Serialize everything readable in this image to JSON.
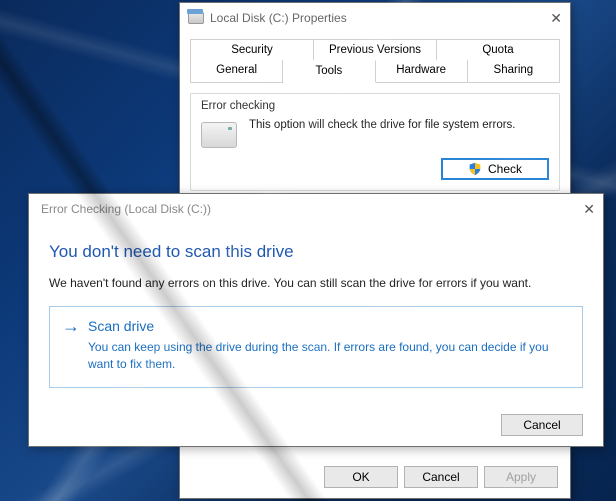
{
  "properties": {
    "title": "Local Disk (C:) Properties",
    "tabs_row1": [
      "Security",
      "Previous Versions",
      "Quota"
    ],
    "tabs_row2": [
      "General",
      "Tools",
      "Hardware",
      "Sharing"
    ],
    "active_tab": "Tools",
    "error_checking": {
      "group_label": "Error checking",
      "description": "This option will check the drive for file system errors.",
      "check_button": "Check"
    },
    "buttons": {
      "ok": "OK",
      "cancel": "Cancel",
      "apply": "Apply"
    }
  },
  "error_dialog": {
    "title": "Error Checking (Local Disk (C:))",
    "heading": "You don't need to scan this drive",
    "body": "We haven't found any errors on this drive. You can still scan the drive for errors if you want.",
    "scan": {
      "title": "Scan drive",
      "description": "You can keep using the drive during the scan. If errors are found, you can decide if you want to fix them."
    },
    "cancel": "Cancel"
  }
}
